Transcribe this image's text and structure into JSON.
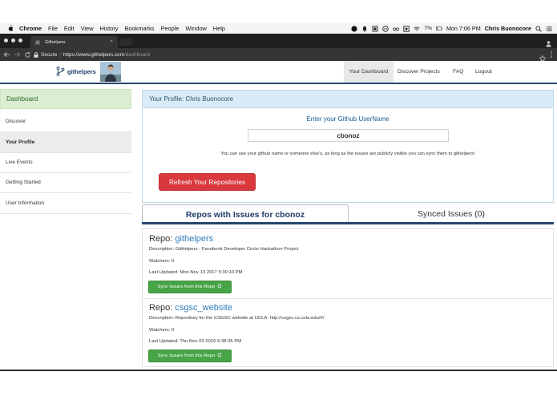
{
  "menubar": {
    "items": [
      "Chrome",
      "File",
      "Edit",
      "View",
      "History",
      "Bookmarks",
      "People",
      "Window",
      "Help"
    ],
    "battery": "7%",
    "clock": "Mon 7:06 PM",
    "user": "Chris Buonocore"
  },
  "browser": {
    "tab_title": "Githelpers",
    "tab_close": "×",
    "secure_label": "Secure",
    "url_host": "https://www.githelpers.com",
    "url_path": "/dashboard"
  },
  "site": {
    "brand": "githelpers",
    "nav": [
      "Your Dashboard",
      "Discover Projects",
      "FAQ",
      "Logout"
    ]
  },
  "sidebar": {
    "items": [
      "Dashboard",
      "Discover",
      "Your Profile",
      "Live Events",
      "Getting Started",
      "User Information"
    ]
  },
  "profile": {
    "panel_title": "Your Profile: Chris Buonocore",
    "github_label": "Enter your Github UserName",
    "username_value": "cbonoz",
    "note": "You can use your github name or someone else's, as long as the issues are publicly visible you can sync them to githelpers!",
    "refresh_button": "Refresh Your Repositories"
  },
  "tabs": {
    "repos": "Repos with Issues for cbonoz",
    "synced": "Synced Issues (0)"
  },
  "repos": [
    {
      "prefix": "Repo: ",
      "name": "githelpers",
      "description": "Description: GitHelpers - Facebook Developer Circle Hackathon Project",
      "watchers": "Watchers: 0",
      "updated": "Last Updated: Mon Nov 13 2017 5:30:10 PM",
      "sync_button": "Sync Issues from this Repo"
    },
    {
      "prefix": "Repo: ",
      "name": "csgsc_website",
      "description": "Description: Repository for the CSGSC website at UCLA. http://csgsc.cs.ucla.edu/#/",
      "watchers": "Watchers: 0",
      "updated": "Last Updated: Thu Nov 03 2016 6:38:35 PM",
      "sync_button": "Sync Issues from this Repo"
    }
  ],
  "colors": {
    "header_rule": "#26466d",
    "dashboard_active_bg": "#dbeed3",
    "refresh_button": "#d9383c",
    "sync_button": "#47a447",
    "link": "#2f79b8"
  },
  "icons": {
    "apple": "apple-icon",
    "sync": "refresh-icon",
    "lock": "lock-icon",
    "star": "star-icon"
  }
}
